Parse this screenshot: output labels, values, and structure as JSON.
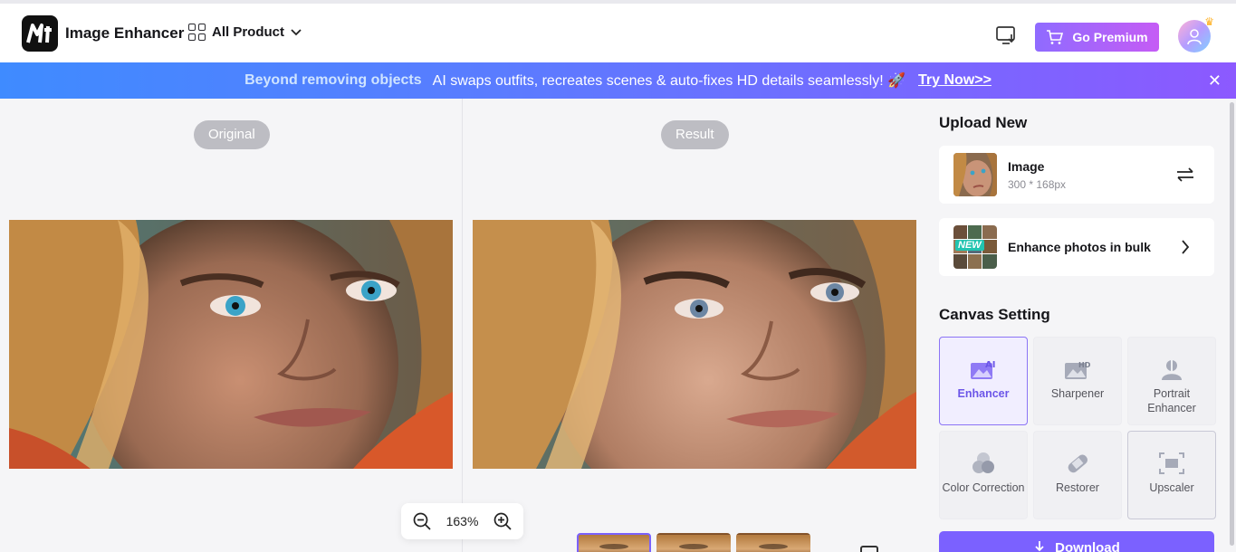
{
  "header": {
    "app_title": "Image Enhancer",
    "all_product_label": "All Product",
    "premium_label": "Go Premium"
  },
  "banner": {
    "bold_text": "Beyond removing objects",
    "text": "AI swaps outfits, recreates scenes & auto-fixes HD details seamlessly! 🚀",
    "link": "Try Now>>"
  },
  "workspace": {
    "original_label": "Original",
    "result_label": "Result",
    "zoom_level": "163%"
  },
  "panel": {
    "upload_title": "Upload New",
    "image_card": {
      "title": "Image",
      "size": "300 * 168px"
    },
    "bulk_card": {
      "title": "Enhance photos in bulk",
      "badge": "NEW"
    },
    "canvas_title": "Canvas Setting",
    "tools": {
      "enhancer": "Enhancer",
      "sharpener": "Sharpener",
      "portrait": "Portrait Enhancer",
      "color": "Color Correction",
      "restorer": "Restorer",
      "upscaler": "Upscaler"
    },
    "download_label": "Download"
  },
  "colors": {
    "accent": "#7b61ff",
    "banner_start": "#3f8bff",
    "banner_end": "#8c59ff",
    "premium_start": "#8f6bff",
    "premium_end": "#c55cf5"
  }
}
